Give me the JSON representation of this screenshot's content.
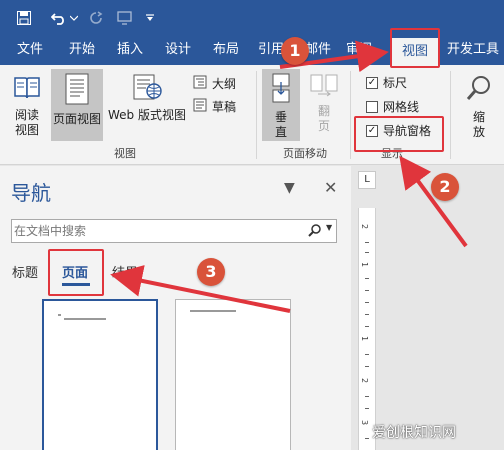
{
  "colors": {
    "brand": "#2b579a",
    "annotation": "#e0353c",
    "badge": "#d9533a"
  },
  "quick_access": {
    "icons": [
      "save-icon",
      "undo-icon",
      "undo-dropdown-icon",
      "redo-icon",
      "touch-mode-icon",
      "customize-icon"
    ]
  },
  "tabs": [
    {
      "label": "文件"
    },
    {
      "label": "开始"
    },
    {
      "label": "插入"
    },
    {
      "label": "设计"
    },
    {
      "label": "布局"
    },
    {
      "label": "引用"
    },
    {
      "label": "邮件"
    },
    {
      "label": "审阅"
    },
    {
      "label": "视图",
      "active": true
    },
    {
      "label": "开发工具"
    }
  ],
  "ribbon": {
    "views_group": {
      "label": "视图",
      "read_mode": "阅读\n视图",
      "print_layout": "页面视图",
      "web_layout": "Web 版式视图",
      "outline": "大纲",
      "draft": "草稿"
    },
    "page_move_group": {
      "label": "页面移动",
      "vertical": "垂\n直",
      "side_to_side": "翻\n页"
    },
    "show_group": {
      "label": "显示",
      "ruler": "标尺",
      "ruler_checked": true,
      "gridlines": "网格线",
      "gridlines_checked": false,
      "nav_pane": "导航窗格",
      "nav_pane_checked": true
    },
    "zoom_group": {
      "zoom": "缩\n放"
    }
  },
  "nav_pane": {
    "title": "导航",
    "search_placeholder": "在文档中搜索",
    "tabs": [
      "标题",
      "页面",
      "结果"
    ],
    "active_tab": "页面"
  },
  "ruler": {
    "corner": "L",
    "numbers": [
      "2",
      "1",
      "1",
      "2",
      "3"
    ]
  },
  "annotations": {
    "badges": [
      "1",
      "2",
      "3"
    ]
  },
  "watermark": "爱创根知识网"
}
